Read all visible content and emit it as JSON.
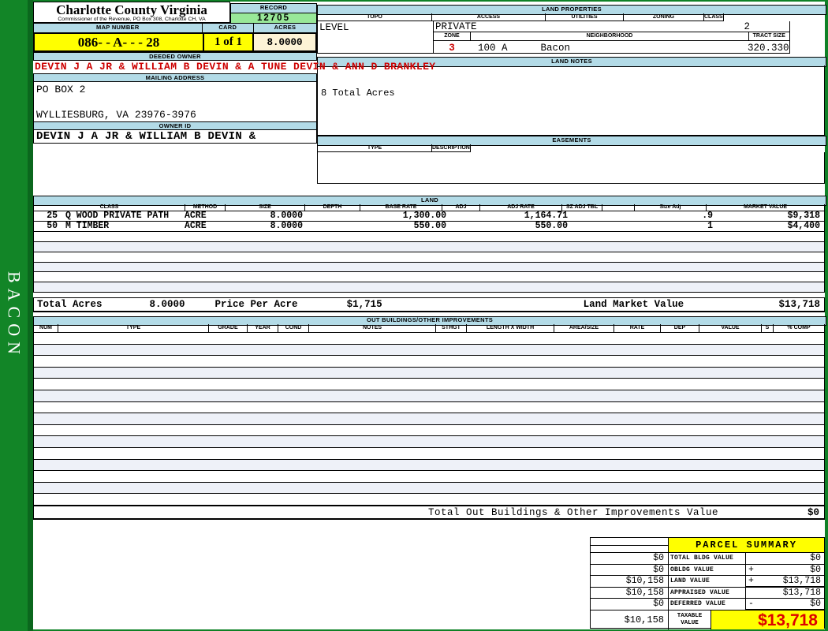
{
  "sidebar": {
    "label": "BACON"
  },
  "header": {
    "county_title": "Charlotte County Virginia",
    "county_subtitle": "Commissioner of the Revenue, PO Box 308, Charlotte CH, VA",
    "record_label": "RECORD",
    "record_value": "12705",
    "map_number_label": "MAP NUMBER",
    "map_number_value": "086- - A- - - 28",
    "card_label": "CARD",
    "card_value": "1 of 1",
    "acres_label": "ACRES",
    "acres_value": "8.0000"
  },
  "owner": {
    "deeded_owner_label": "DEEDED OWNER",
    "deeded_owner_value": "DEVIN J A JR & WILLIAM B DEVIN & A TUNE DEVIN & ANN D BRANKLEY",
    "mailing_address_label": "MAILING ADDRESS",
    "mailing_address_line1": "PO BOX 2",
    "mailing_address_line2": "WYLLIESBURG, VA 23976-3976",
    "owner_id_label": "OWNER ID",
    "owner_id_value": "DEVIN J A JR & WILLIAM B DEVIN &"
  },
  "land_properties": {
    "section_label": "LAND PROPERTIES",
    "topo_label": "TOPO",
    "topo_value": "LEVEL",
    "access_label": "ACCESS",
    "access_value": "PRIVATE",
    "utilities_label": "UTILITIES",
    "utilities_value": "",
    "zoning_label": "ZONING",
    "zoning_value": "",
    "class_label": "CLASS",
    "class_value": "2",
    "zone_label": "ZONE",
    "zone_value": "3",
    "neighborhood_label": "NEIGHBORHOOD",
    "neighborhood_code": "100 A",
    "neighborhood_name": "Bacon",
    "tract_size_label": "TRACT SIZE",
    "tract_size_value": "320.330"
  },
  "land_notes": {
    "section_label": "LAND NOTES",
    "note": "8 Total Acres"
  },
  "easements": {
    "section_label": "EASEMENTS",
    "type_label": "TYPE",
    "description_label": "DESCRIPTION"
  },
  "land": {
    "section_label": "LAND",
    "columns": [
      "CLASS",
      "METHOD",
      "SIZE",
      "DEPTH",
      "BASE RATE",
      "ADJ",
      "ADJ RATE",
      "SZ ADJ TBL",
      "",
      "Size Adj",
      "MARKET VALUE"
    ],
    "rows": [
      {
        "num": "25",
        "class": "Q WOOD PRIVATE PATH",
        "method": "ACRE",
        "size": "8.0000",
        "depth": "",
        "base_rate": "1,300.00",
        "adj": "",
        "adj_rate": "1,164.71",
        "sz_adj_tbl": "",
        "size_adj": ".9",
        "market_value": "$9,318"
      },
      {
        "num": "50",
        "class": "M TIMBER",
        "method": "ACRE",
        "size": "8.0000",
        "depth": "",
        "base_rate": "550.00",
        "adj": "",
        "adj_rate": "550.00",
        "sz_adj_tbl": "",
        "size_adj": "1",
        "market_value": "$4,400"
      }
    ],
    "totals": {
      "total_acres_label": "Total Acres",
      "total_acres_value": "8.0000",
      "price_per_acre_label": "Price Per Acre",
      "price_per_acre_value": "$1,715",
      "market_value_label": "Land Market Value",
      "market_value_value": "$13,718"
    }
  },
  "out_buildings": {
    "section_label": "OUT BUILDINGS/OTHER IMPROVEMENTS",
    "columns": [
      "NUM",
      "TYPE",
      "GRADE",
      "YEAR",
      "COND",
      "NOTES",
      "STHGT",
      "LENGTH X WIDTH",
      "AREA/SIZE",
      "RATE",
      "DEP",
      "VALUE",
      "S",
      "% COMP"
    ],
    "total_label": "Total Out Buildings & Other Improvements Value",
    "total_value": "$0"
  },
  "parcel_summary": {
    "title": "PARCEL SUMMARY",
    "rows": [
      {
        "prior": "$0",
        "label": "TOTAL BLDG VALUE",
        "op": "",
        "value": "$0"
      },
      {
        "prior": "$0",
        "label": "OBLDG VALUE",
        "op": "+",
        "value": "$0"
      },
      {
        "prior": "$10,158",
        "label": "LAND VALUE",
        "op": "+",
        "value": "$13,718"
      },
      {
        "prior": "$10,158",
        "label": "APPRAISED VALUE",
        "op": "",
        "value": "$13,718"
      },
      {
        "prior": "$0",
        "label": "DEFERRED VALUE",
        "op": "-",
        "value": "$0"
      },
      {
        "prior": "$10,158",
        "label_line1": "TAXABLE",
        "label_line2": "VALUE",
        "op": "",
        "value": "$13,718"
      }
    ]
  },
  "colors": {
    "border_green": "#0f8126",
    "section_header_blue": "#b3dbe7",
    "highlight_yellow": "#ffff00",
    "record_green": "#98e898",
    "acres_cream": "#fdf3d6",
    "alert_red": "#cc0000"
  }
}
